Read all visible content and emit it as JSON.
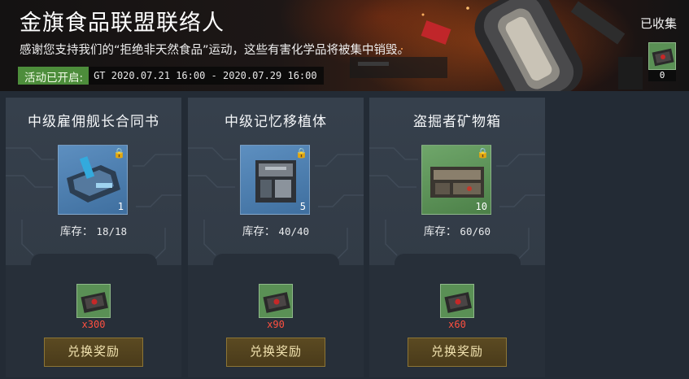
{
  "banner": {
    "title": "金旗食品联盟联络人",
    "subtitle": "感谢您支持我们的“拒绝非天然食品”运动，这些有害化学品将被集中销毁。",
    "event_label": "活动已开启:",
    "event_time": "GT 2020.07.21 16:00 - 2020.07.29 16:00",
    "collected_label": "已收集",
    "collected_count": "0",
    "collected_icon": "toxic-case-icon"
  },
  "cards": [
    {
      "title": "中级雇佣舰长合同书",
      "item_icon": "captain-contract-icon",
      "item_qty": "1",
      "stock_label": "库存：",
      "stock_value": "18/18",
      "cost": "x300",
      "button": "兑换奖励"
    },
    {
      "title": "中级记忆移植体",
      "item_icon": "memory-implant-icon",
      "item_qty": "5",
      "stock_label": "库存：",
      "stock_value": "40/40",
      "cost": "x90",
      "button": "兑换奖励"
    },
    {
      "title": "盗掘者矿物箱",
      "item_icon": "mineral-crate-icon",
      "item_qty": "10",
      "stock_label": "库存：",
      "stock_value": "60/60",
      "cost": "x60",
      "button": "兑换奖励"
    }
  ],
  "colors": {
    "event_label_bg": "#4d8d3b",
    "cost_text": "#ff5040",
    "button_bg": "#5b4a22",
    "card_bg": "#36404c",
    "card_lower_bg": "#272f39"
  }
}
